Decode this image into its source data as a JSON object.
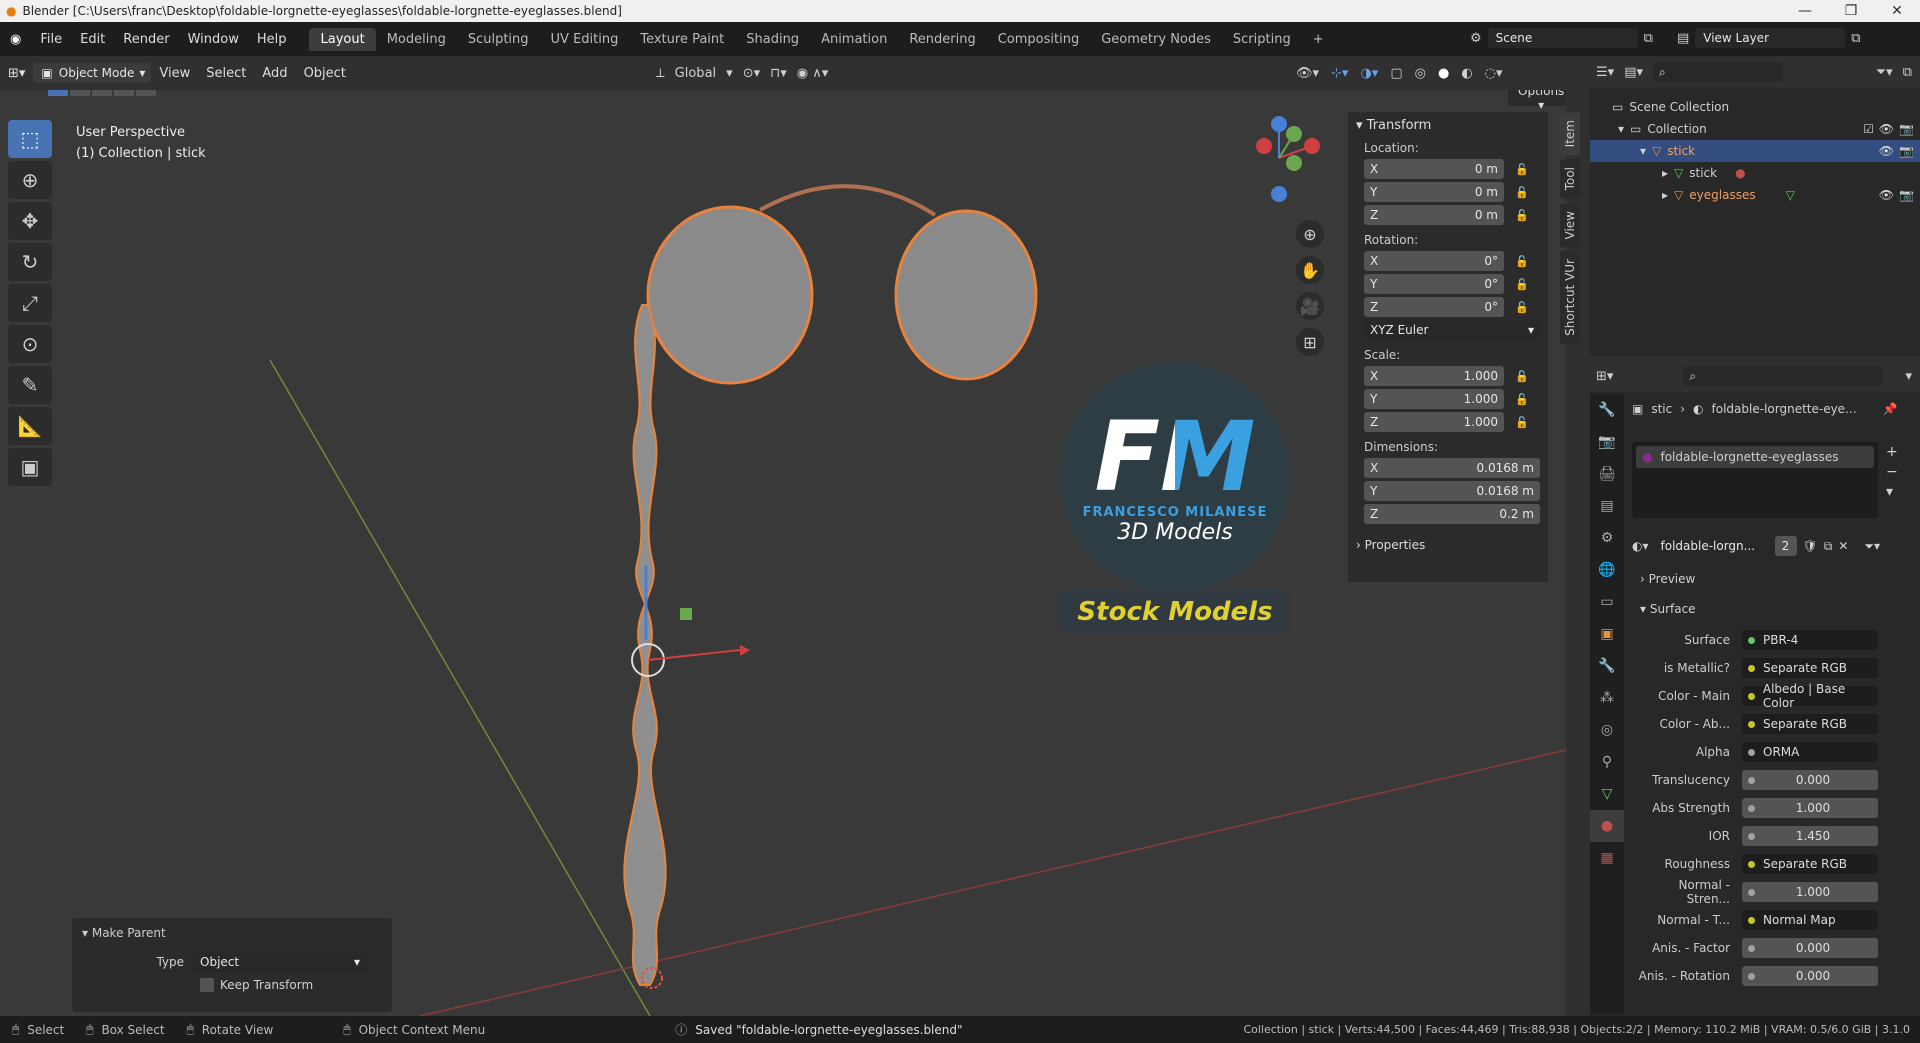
{
  "window": {
    "title": "Blender [C:\\Users\\franc\\Desktop\\foldable-lorgnette-eyeglasses\\foldable-lorgnette-eyeglasses.blend]"
  },
  "menu": {
    "items": [
      "File",
      "Edit",
      "Render",
      "Window",
      "Help"
    ]
  },
  "workspaces": [
    "Layout",
    "Modeling",
    "Sculpting",
    "UV Editing",
    "Texture Paint",
    "Shading",
    "Animation",
    "Rendering",
    "Compositing",
    "Geometry Nodes",
    "Scripting"
  ],
  "scene": {
    "label": "Scene",
    "view_layer": "View Layer"
  },
  "viewport_header": {
    "mode": "Object Mode",
    "menus": [
      "View",
      "Select",
      "Add",
      "Object"
    ],
    "orientation": "Global",
    "options": "Options"
  },
  "viewport": {
    "perspective": "User Perspective",
    "context": "(1) Collection | stick"
  },
  "watermark": {
    "initials": "FM",
    "author": "FRANCESCO MILANESE",
    "sub": "3D Models",
    "banner": "Stock Models"
  },
  "npanel": {
    "title": "Transform",
    "location_label": "Location:",
    "location": [
      {
        "axis": "X",
        "value": "0 m"
      },
      {
        "axis": "Y",
        "value": "0 m"
      },
      {
        "axis": "Z",
        "value": "0 m"
      }
    ],
    "rotation_label": "Rotation:",
    "rotation": [
      {
        "axis": "X",
        "value": "0°"
      },
      {
        "axis": "Y",
        "value": "0°"
      },
      {
        "axis": "Z",
        "value": "0°"
      }
    ],
    "rotation_mode": "XYZ Euler",
    "scale_label": "Scale:",
    "scale": [
      {
        "axis": "X",
        "value": "1.000"
      },
      {
        "axis": "Y",
        "value": "1.000"
      },
      {
        "axis": "Z",
        "value": "1.000"
      }
    ],
    "dimensions_label": "Dimensions:",
    "dimensions": [
      {
        "axis": "X",
        "value": "0.0168 m"
      },
      {
        "axis": "Y",
        "value": "0.0168 m"
      },
      {
        "axis": "Z",
        "value": "0.2 m"
      }
    ],
    "properties": "Properties",
    "tabs": [
      "Item",
      "Tool",
      "View",
      "Shortcut VUr"
    ]
  },
  "outliner": {
    "root": "Scene Collection",
    "collection": "Collection",
    "items": [
      {
        "name": "stick",
        "indent": 0
      },
      {
        "name": "stick",
        "indent": 1
      },
      {
        "name": "eyeglasses",
        "indent": 1
      }
    ]
  },
  "properties": {
    "breadcrumb_obj": "stic",
    "breadcrumb_mat": "foldable-lorgnette-eye...",
    "material_slot": "foldable-lorgnette-eyeglasses",
    "material_name": "foldable-lorgn...",
    "users": "2",
    "preview": "Preview",
    "surface_section": "Surface",
    "rows": [
      {
        "label": "Surface",
        "value": "PBR-4",
        "type": "link",
        "color": "g"
      },
      {
        "label": "is Metallic?",
        "value": "Separate RGB",
        "type": "link",
        "color": "y"
      },
      {
        "label": "Color - Main",
        "value": "Albedo | Base Color",
        "type": "link",
        "color": "y"
      },
      {
        "label": "Color - Ab...",
        "value": "Separate RGB",
        "type": "link",
        "color": "y"
      },
      {
        "label": "Alpha",
        "value": "ORMA",
        "type": "link",
        "color": "gr"
      },
      {
        "label": "Translucency",
        "value": "0.000",
        "type": "num",
        "color": "gr"
      },
      {
        "label": "Abs Strength",
        "value": "1.000",
        "type": "num",
        "color": "gr"
      },
      {
        "label": "IOR",
        "value": "1.450",
        "type": "num",
        "color": "gr"
      },
      {
        "label": "Roughness",
        "value": "Separate RGB",
        "type": "link",
        "color": "y"
      },
      {
        "label": "Normal - Stren...",
        "value": "1.000",
        "type": "num",
        "color": "gr"
      },
      {
        "label": "Normal - T...",
        "value": "Normal Map",
        "type": "link",
        "color": "y"
      },
      {
        "label": "Anis. - Factor",
        "value": "0.000",
        "type": "num",
        "color": "gr"
      },
      {
        "label": "Anis. - Rotation",
        "value": "0.000",
        "type": "num",
        "color": "gr"
      }
    ]
  },
  "make_parent": {
    "title": "Make Parent",
    "type_label": "Type",
    "type_value": "Object",
    "keep": "Keep Transform"
  },
  "status": {
    "select": "Select",
    "box": "Box Select",
    "rotate": "Rotate View",
    "ctx": "Object Context Menu",
    "saved": "Saved \"foldable-lorgnette-eyeglasses.blend\"",
    "stats": "Collection | stick | Verts:44,500 | Faces:44,469 | Tris:88,938 | Objects:2/2 | Memory: 110.2 MiB | VRAM: 0.5/6.0 GiB | 3.1.0"
  }
}
